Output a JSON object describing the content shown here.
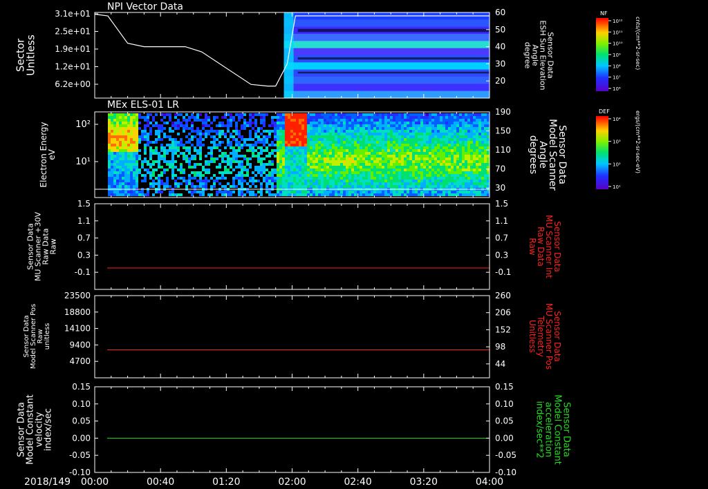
{
  "date_label": "2018/149",
  "time_ticks": [
    "00:00",
    "00:40",
    "01:20",
    "02:00",
    "02:40",
    "03:20",
    "04:00"
  ],
  "colors": {
    "background": "#000000",
    "axis": "#ffffff",
    "red_trace": "#ff2020",
    "green_trace": "#22dd22",
    "white_trace": "#ffffff"
  },
  "chart_data": [
    {
      "type": "heatmap",
      "title": "NPI Vector Data",
      "ylabel_left": [
        "Sector",
        "Unitless"
      ],
      "yticks_left": [
        "3.1e+01",
        "2.5e+01",
        "1.9e+01",
        "1.2e+01",
        "6.2e+00"
      ],
      "ylabel_right": [
        "Sensor Data",
        "ESH Sun Elevation",
        "Angle",
        "degree"
      ],
      "yticks_right": [
        "60",
        "50",
        "40",
        "30",
        "20"
      ],
      "ylim_right": [
        10,
        60
      ],
      "colorbar": {
        "label": "NF",
        "unit": "cnts/(cm**2-sr-sec)",
        "ticks": [
          "10¹²",
          "10¹¹",
          "10¹⁰",
          "10⁹",
          "10⁸",
          "10⁷",
          "10⁶"
        ]
      },
      "heatmap_start_time": "01:55",
      "overlay_line": {
        "name": "Sensor Data ESH Sun Elevation Angle",
        "x": [
          "00:00",
          "00:08",
          "00:20",
          "00:30",
          "00:55",
          "01:05",
          "01:35",
          "01:45",
          "01:50",
          "01:57",
          "02:02",
          "04:00"
        ],
        "y": [
          59,
          58,
          42,
          40,
          40,
          37,
          18,
          17,
          17,
          30,
          58,
          58
        ]
      }
    },
    {
      "type": "heatmap",
      "title": "MEx ELS-01 LR",
      "ylabel_left": [
        "Electron Energy",
        "eV"
      ],
      "yticks_left": [
        "10²",
        "10¹"
      ],
      "ylabel_right": [
        "Sensor Data",
        "Model Scanner",
        "Angle",
        "degrees"
      ],
      "yticks_right": [
        "190",
        "150",
        "110",
        "70",
        "30"
      ],
      "ylim_right": [
        10,
        190
      ],
      "colorbar": {
        "label": "DEF",
        "unit": "ergs/(cm**2-sr-sec-eV)",
        "ticks": [
          "10⁴",
          "10³",
          "10²",
          "10¹"
        ]
      },
      "data_start_time": "00:08",
      "overlay_line": {
        "name": "Sensor Data Model Scanner Angle",
        "x": [
          "00:00",
          "04:00"
        ],
        "y": [
          20,
          20
        ]
      }
    },
    {
      "type": "line",
      "ylabel_left": [
        "Sensor Data",
        "MU Scanner +30V",
        "Raw Data",
        "Raw"
      ],
      "yticks_left": [
        "1.5",
        "1.1",
        "0.7",
        "0.3",
        "-0.1"
      ],
      "ylim_left": [
        -0.5,
        1.5
      ],
      "ylabel_right": [
        "Sensor Data",
        "MU Scanner Int",
        "Raw Data",
        "Raw"
      ],
      "yticks_right": [
        "1.5",
        "1.1",
        "0.7",
        "0.3",
        "-0.1"
      ],
      "ylim_right": [
        -0.5,
        1.5
      ],
      "series": [
        {
          "x": [
            "00:00",
            "04:00"
          ],
          "y": [
            0.0,
            0.0
          ]
        }
      ]
    },
    {
      "type": "line",
      "ylabel_left": [
        "Sensor Data",
        "Model Scanner Pos",
        "Raw",
        "unitless"
      ],
      "yticks_left": [
        "23500",
        "18800",
        "14100",
        "9400",
        "4700"
      ],
      "ylim_left": [
        0,
        23500
      ],
      "ylabel_right": [
        "Sensor Data",
        "MU Scanner Pos",
        "Telemetry",
        "Unitless"
      ],
      "yticks_right": [
        "260",
        "206",
        "152",
        "98",
        "44"
      ],
      "ylim_right": [
        0,
        260
      ],
      "series": [
        {
          "x": [
            "00:00",
            "04:00"
          ],
          "y": [
            8000,
            8000
          ]
        }
      ]
    },
    {
      "type": "line",
      "ylabel_left": [
        "Sensor Data",
        "Model Constant",
        "velocity",
        "index/sec"
      ],
      "yticks_left": [
        "0.15",
        "0.10",
        "0.05",
        "0.00",
        "-0.05",
        "-0.10"
      ],
      "ylim_left": [
        -0.1,
        0.15
      ],
      "ylabel_right": [
        "Sensor Data",
        "Model Constant",
        "acceleration",
        "index/sec**2"
      ],
      "yticks_right": [
        "0.15",
        "0.10",
        "0.05",
        "0.00",
        "-0.05",
        "-0.10"
      ],
      "ylim_right": [
        -0.1,
        0.15
      ],
      "series": [
        {
          "x": [
            "00:00",
            "04:00"
          ],
          "y": [
            0.0,
            0.0
          ]
        }
      ]
    }
  ]
}
